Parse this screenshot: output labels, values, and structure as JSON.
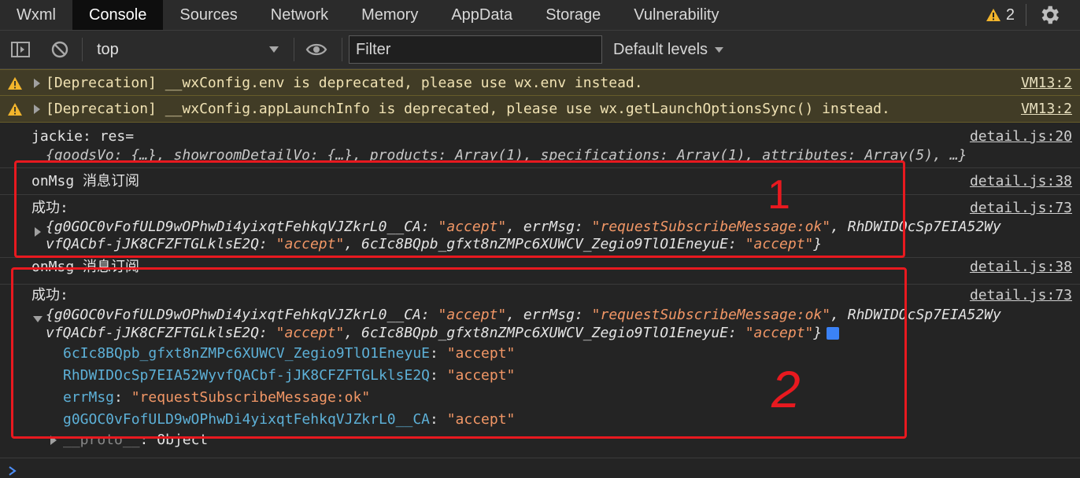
{
  "tabs": [
    "Wxml",
    "Console",
    "Sources",
    "Network",
    "Memory",
    "AppData",
    "Storage",
    "Vulnerability"
  ],
  "warning_count": "2",
  "toolbar": {
    "context": "top",
    "filter_placeholder": "Filter",
    "levels": "Default levels"
  },
  "warnings": [
    {
      "text": "[Deprecation] __wxConfig.env is deprecated, please use wx.env instead.",
      "source": "VM13:2"
    },
    {
      "text": "[Deprecation] __wxConfig.appLaunchInfo is deprecated, please use wx.getLaunchOptionsSync() instead.",
      "source": "VM13:2"
    }
  ],
  "log1": {
    "label": "jackie: res=",
    "source": "detail.js:20",
    "summary": "{goodsVo: {…}, showroomDetailVo: {…}, products: Array(1), specifications: Array(1), attributes: Array(5), …}"
  },
  "group1": {
    "onmsg": "onMsg 消息订阅",
    "onmsg_source": "detail.js:38",
    "success": "成功:",
    "success_source": "detail.js:73",
    "k1": "g0GOC0vFofULD9wOPhwDi4yixqtFehkqVJZkrL0__CA",
    "v1": "\"accept\"",
    "k2": "errMsg",
    "v2": "\"requestSubscribeMessage:ok\"",
    "k3a": "RhDWIDOcSp7EIA52Wy",
    "k3b": "vfQACbf-jJK8CFZFTGLklsE2Q",
    "v3": "\"accept\"",
    "k4": "6cIc8BQpb_gfxt8nZMPc6XUWCV_Zegio9TlO1EneyuE",
    "v4": "\"accept\""
  },
  "group2": {
    "onmsg": "onMsg 消息订阅",
    "onmsg_source": "detail.js:38",
    "success": "成功:",
    "success_source": "detail.js:73",
    "expanded": [
      {
        "key": "6cIc8BQpb_gfxt8nZMPc6XUWCV_Zegio9TlO1EneyuE",
        "value": "\"accept\""
      },
      {
        "key": "RhDWIDOcSp7EIA52WyvfQACbf-jJK8CFZFTGLklsE2Q",
        "value": "\"accept\""
      },
      {
        "key": "errMsg",
        "value": "\"requestSubscribeMessage:ok\""
      },
      {
        "key": "g0GOC0vFofULD9wOPhwDi4yixqtFehkqVJZkrL0__CA",
        "value": "\"accept\""
      }
    ],
    "proto": "__proto__",
    "proto_value": "Object"
  },
  "annotations": [
    "1",
    "2"
  ],
  "colors": {
    "annotation": "#e8191f",
    "string": "#f29766",
    "key": "#5db0d7",
    "warning_bg": "#413c26"
  }
}
